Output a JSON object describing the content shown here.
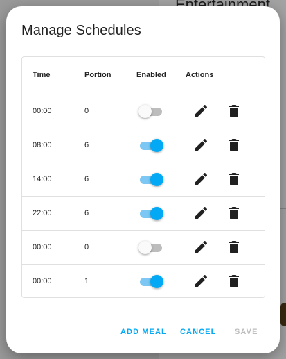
{
  "background": {
    "title": "Entertainment"
  },
  "dialog": {
    "title": "Manage Schedules",
    "columns": {
      "time": "Time",
      "portion": "Portion",
      "enabled": "Enabled",
      "actions": "Actions"
    },
    "rows": [
      {
        "time": "00:00",
        "portion": "0",
        "enabled": false
      },
      {
        "time": "08:00",
        "portion": "6",
        "enabled": true
      },
      {
        "time": "14:00",
        "portion": "6",
        "enabled": true
      },
      {
        "time": "22:00",
        "portion": "6",
        "enabled": true
      },
      {
        "time": "00:00",
        "portion": "0",
        "enabled": false
      },
      {
        "time": "00:00",
        "portion": "1",
        "enabled": true
      }
    ],
    "buttons": {
      "add_meal": "ADD MEAL",
      "cancel": "CANCEL",
      "save": "SAVE"
    }
  },
  "colors": {
    "accent": "#03a9f4",
    "accent_track": "#7cc7f3",
    "disabled": "#bdbdbd",
    "text": "#212121"
  },
  "icons": {
    "edit": "pencil-icon",
    "delete": "trash-icon"
  }
}
